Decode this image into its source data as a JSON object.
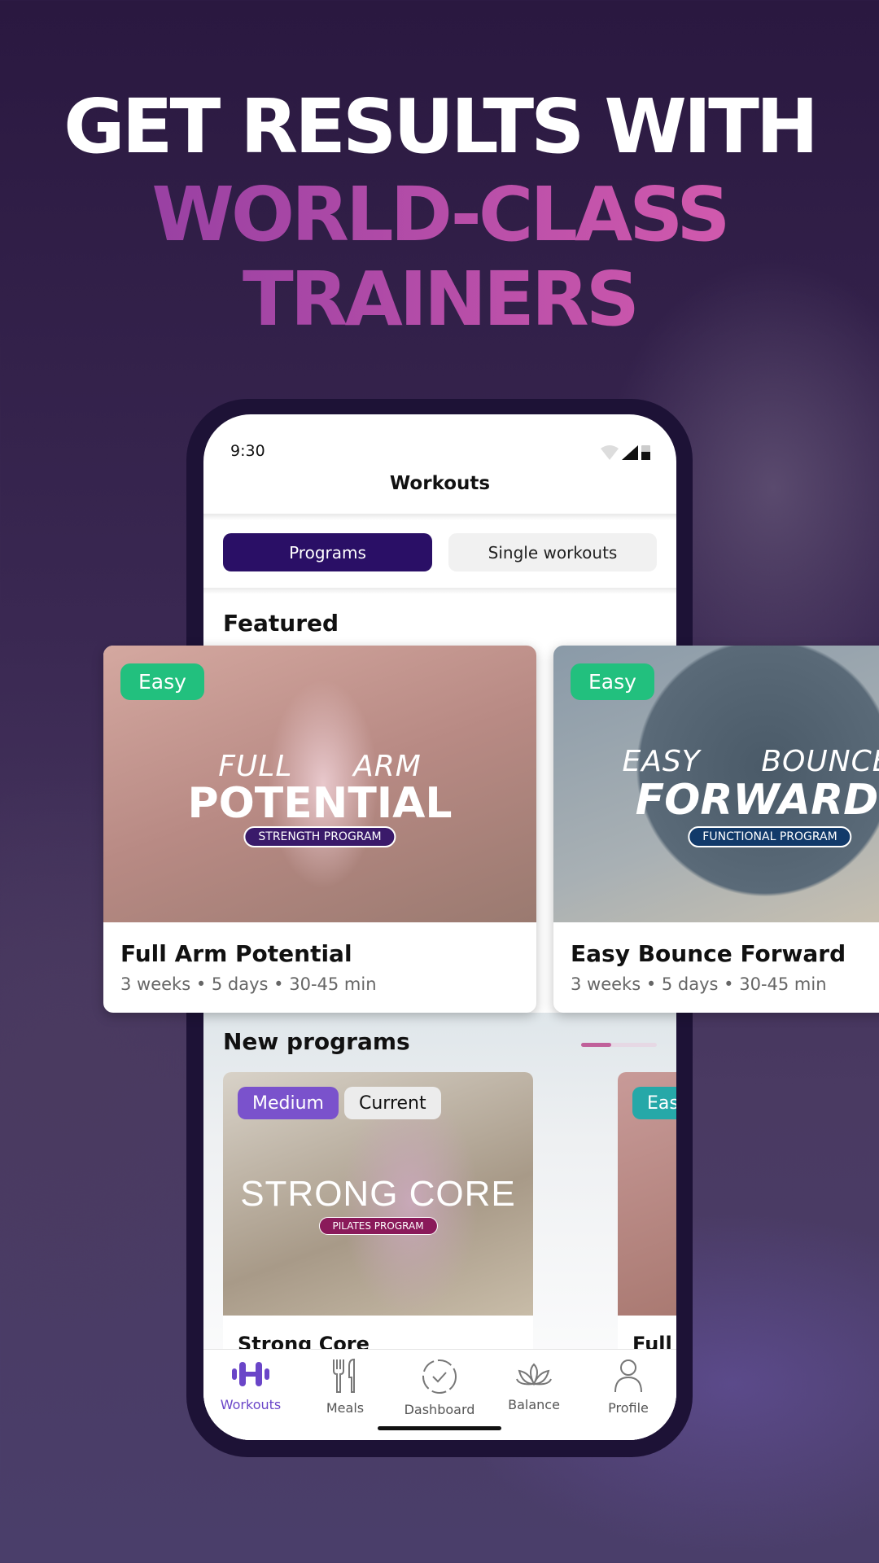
{
  "headline": {
    "line1": "GET RESULTS WITH",
    "line2": "WORLD-CLASS",
    "line3": "TRAINERS"
  },
  "status_bar": {
    "time": "9:30",
    "icons": [
      "wifi-icon",
      "signal-icon",
      "battery-icon"
    ]
  },
  "header": {
    "title": "Workouts"
  },
  "segments": [
    {
      "label": "Programs",
      "selected": true
    },
    {
      "label": "Single workouts",
      "selected": false
    }
  ],
  "featured": {
    "heading": "Featured",
    "cards": [
      {
        "badge": "Easy",
        "logo_thin": "FULL      ARM",
        "logo_bold": "POTENTIAL",
        "logo_tag": "STRENGTH PROGRAM",
        "title": "Full Arm Potential",
        "meta": "3 weeks • 5 days • 30-45 min"
      },
      {
        "badge": "Easy",
        "logo_thin": "EASY      BOUNCE",
        "logo_bold": "FORWARD",
        "logo_tag": "FUNCTIONAL PROGRAM",
        "title": "Easy Bounce Forward",
        "meta": "3 weeks • 5 days • 30-45 min"
      }
    ]
  },
  "new_programs": {
    "heading": "New programs",
    "cards": [
      {
        "badges": [
          "Medium",
          "Current"
        ],
        "logo": "STRONG CORE",
        "logo_tag": "PILATES PROGRAM",
        "title": "Strong Core"
      },
      {
        "badges": [
          "Eas"
        ],
        "title": "Full A"
      }
    ]
  },
  "nav": [
    {
      "label": "Workouts",
      "icon": "dumbbell-icon",
      "active": true
    },
    {
      "label": "Meals",
      "icon": "fork-knife-icon"
    },
    {
      "label": "Dashboard",
      "icon": "dashboard-check-icon"
    },
    {
      "label": "Balance",
      "icon": "lotus-icon"
    },
    {
      "label": "Profile",
      "icon": "person-icon"
    }
  ],
  "colors": {
    "accent": "#2a0f66",
    "active_nav": "#6a45c8",
    "easy": "#22c07e",
    "medium": "#7a52cc"
  }
}
